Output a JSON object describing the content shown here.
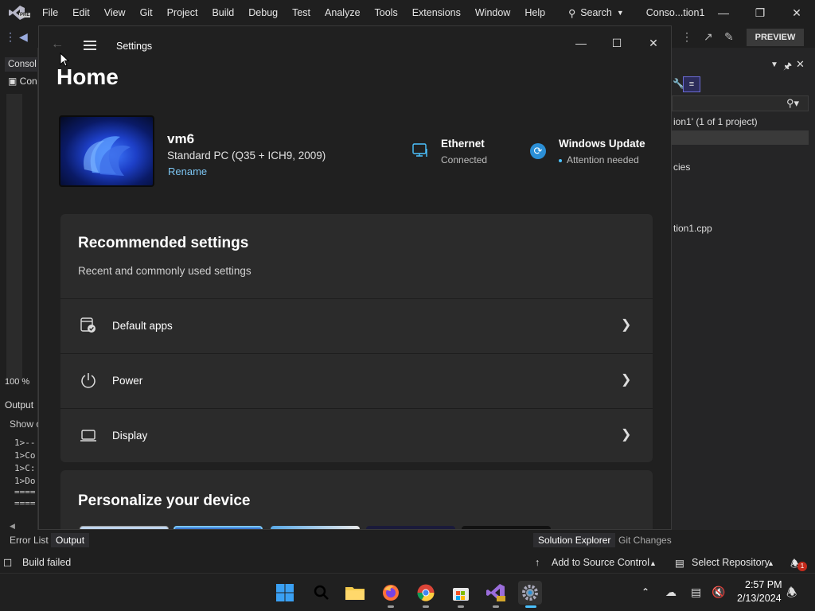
{
  "vs": {
    "menu": [
      "File",
      "Edit",
      "View",
      "Git",
      "Project",
      "Build",
      "Debug",
      "Test",
      "Analyze",
      "Tools",
      "Extensions",
      "Window",
      "Help"
    ],
    "search_label": "Search",
    "window_title": "Conso...tion1",
    "preview_label": "PREVIEW",
    "left_tab": "Consol",
    "left_item": "Con",
    "zoom": "100 %",
    "output_label": "Output",
    "show_label": "Show o",
    "output_lines": [
      "1>--",
      "1>Co",
      "1>C:",
      "1>Do",
      "====",
      "===="
    ],
    "solution_line": "ion1' (1 of 1 project)",
    "deps_line": "cies",
    "cpp_line": "tion1.cpp",
    "bottom_tabs": {
      "error_list": "Error List",
      "output": "Output",
      "solution_explorer": "Solution Explorer",
      "git_changes": "Git Changes"
    },
    "status": {
      "build": "Build failed",
      "source_control": "Add to Source Control",
      "repository": "Select Repository",
      "notifications": "1"
    }
  },
  "taskbar": {
    "apps": [
      "windows-start",
      "search",
      "file-explorer",
      "firefox",
      "chrome",
      "microsoft-store",
      "visual-studio-preview",
      "settings"
    ],
    "time": "2:57 PM",
    "date": "2/13/2024"
  },
  "settings": {
    "window_title": "Settings",
    "page_title": "Home",
    "device": {
      "name": "vm6",
      "model": "Standard PC (Q35 + ICH9, 2009)",
      "rename_label": "Rename"
    },
    "network": {
      "title": "Ethernet",
      "status": "Connected"
    },
    "update": {
      "title": "Windows Update",
      "status": "Attention needed"
    },
    "recommended": {
      "title": "Recommended settings",
      "subtitle": "Recent and commonly used settings",
      "items": [
        {
          "label": "Default apps",
          "icon": "default-apps-icon"
        },
        {
          "label": "Power",
          "icon": "power-icon"
        },
        {
          "label": "Display",
          "icon": "display-icon"
        }
      ]
    },
    "personalize": {
      "title": "Personalize your device"
    }
  },
  "colors": {
    "accent": "#7cc5f2",
    "update_blue": "#2b8fd6",
    "bg": "#202020",
    "card": "#2b2b2b"
  }
}
